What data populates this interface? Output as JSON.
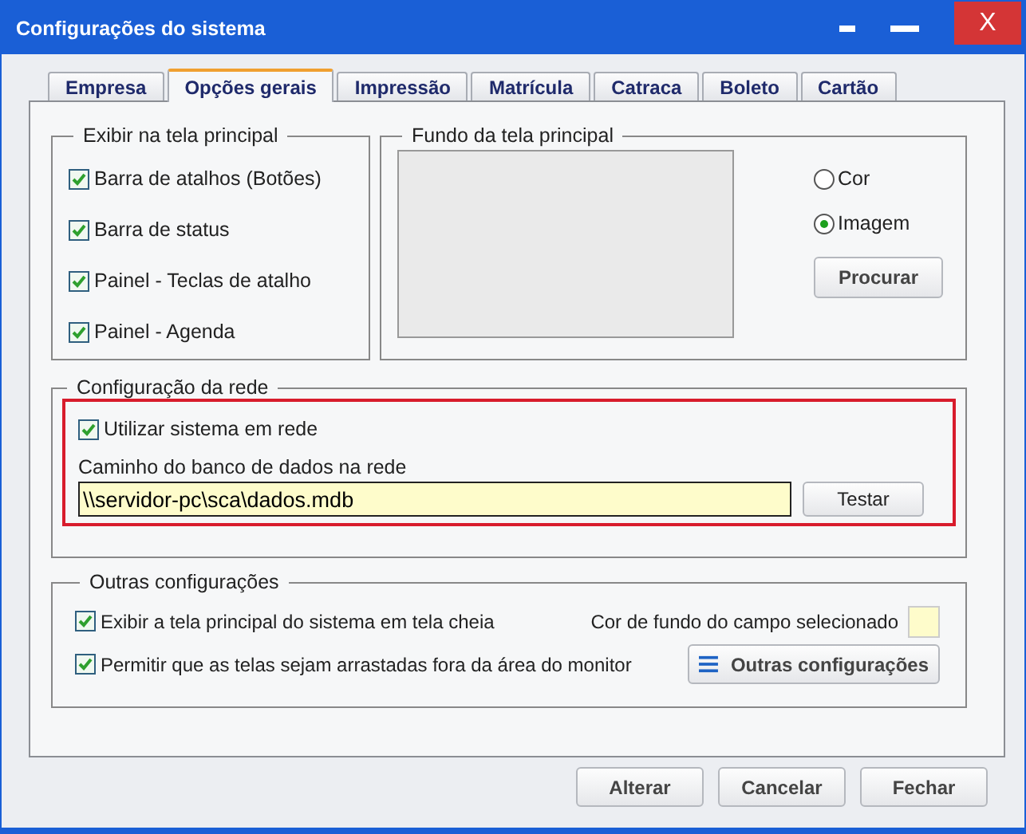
{
  "window": {
    "title": "Configurações do sistema",
    "close_label": "X"
  },
  "tabs": [
    {
      "label": "Empresa",
      "selected": false
    },
    {
      "label": "Opções gerais",
      "selected": true
    },
    {
      "label": "Impressão",
      "selected": false
    },
    {
      "label": "Matrícula",
      "selected": false
    },
    {
      "label": "Catraca",
      "selected": false
    },
    {
      "label": "Boleto",
      "selected": false
    },
    {
      "label": "Cartão",
      "selected": false
    }
  ],
  "display_group": {
    "title": "Exibir na tela principal",
    "options": [
      {
        "label": "Barra de atalhos (Botões)",
        "checked": true
      },
      {
        "label": "Barra de status",
        "checked": true
      },
      {
        "label": "Painel - Teclas de atalho",
        "checked": true
      },
      {
        "label": "Painel - Agenda",
        "checked": true
      }
    ]
  },
  "background_group": {
    "title": "Fundo da tela principal",
    "radios": [
      {
        "label": "Cor",
        "selected": false
      },
      {
        "label": "Imagem",
        "selected": true
      }
    ],
    "browse_button": "Procurar"
  },
  "network_group": {
    "title": "Configuração da rede",
    "highlighted": true,
    "use_network": {
      "label": "Utilizar sistema em rede",
      "checked": true
    },
    "path_label": "Caminho do banco de dados na rede",
    "path_value": "\\\\servidor-pc\\sca\\dados.mdb",
    "test_button": "Testar"
  },
  "other_group": {
    "title": "Outras configurações",
    "options": [
      {
        "label": "Exibir a tela principal do sistema em tela cheia",
        "checked": true
      },
      {
        "label": "Permitir que as telas sejam arrastadas fora da área do monitor",
        "checked": true
      }
    ],
    "field_color_label": "Cor de fundo do campo selecionado",
    "more_button": "Outras configurações"
  },
  "buttons": [
    "Alterar",
    "Cancelar",
    "Fechar"
  ]
}
